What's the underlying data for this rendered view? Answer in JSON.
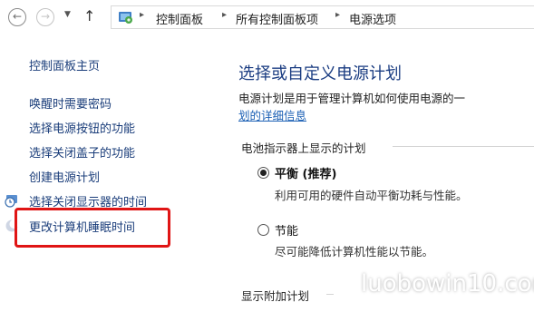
{
  "nav": {
    "back_icon": "arrow-left-icon",
    "forward_icon": "arrow-right-icon",
    "dropdown_icon": "chevron-down-icon",
    "up_icon": "arrow-up-icon",
    "breadcrumbs": [
      "控制面板",
      "所有控制面板项",
      "电源选项"
    ]
  },
  "sidebar": {
    "home": "控制面板主页",
    "items": [
      {
        "label": "唤醒时需要密码"
      },
      {
        "label": "选择电源按钮的功能"
      },
      {
        "label": "选择关闭盖子的功能"
      },
      {
        "label": "创建电源计划"
      },
      {
        "label": "选择关闭显示器的时间"
      },
      {
        "label": "更改计算机睡眠时间"
      }
    ]
  },
  "main": {
    "title": "选择或自定义电源计划",
    "description": "电源计划是用于管理计算机如何使用电源的一",
    "details_link": "划的详细信息",
    "battery_section": "电池指示器上显示的计划",
    "plans": [
      {
        "name": "平衡 (推荐)",
        "description": "利用可用的硬件自动平衡功耗与性能。",
        "selected": true
      },
      {
        "name": "节能",
        "description": "尽可能降低计算机性能以节能。",
        "selected": false
      }
    ],
    "additional_section": "显示附加计划"
  },
  "watermark": {
    "text": "luobowin10.com"
  },
  "colors": {
    "link": "#1a3d7a",
    "title": "#1b3d82",
    "highlight": "#e01515"
  }
}
